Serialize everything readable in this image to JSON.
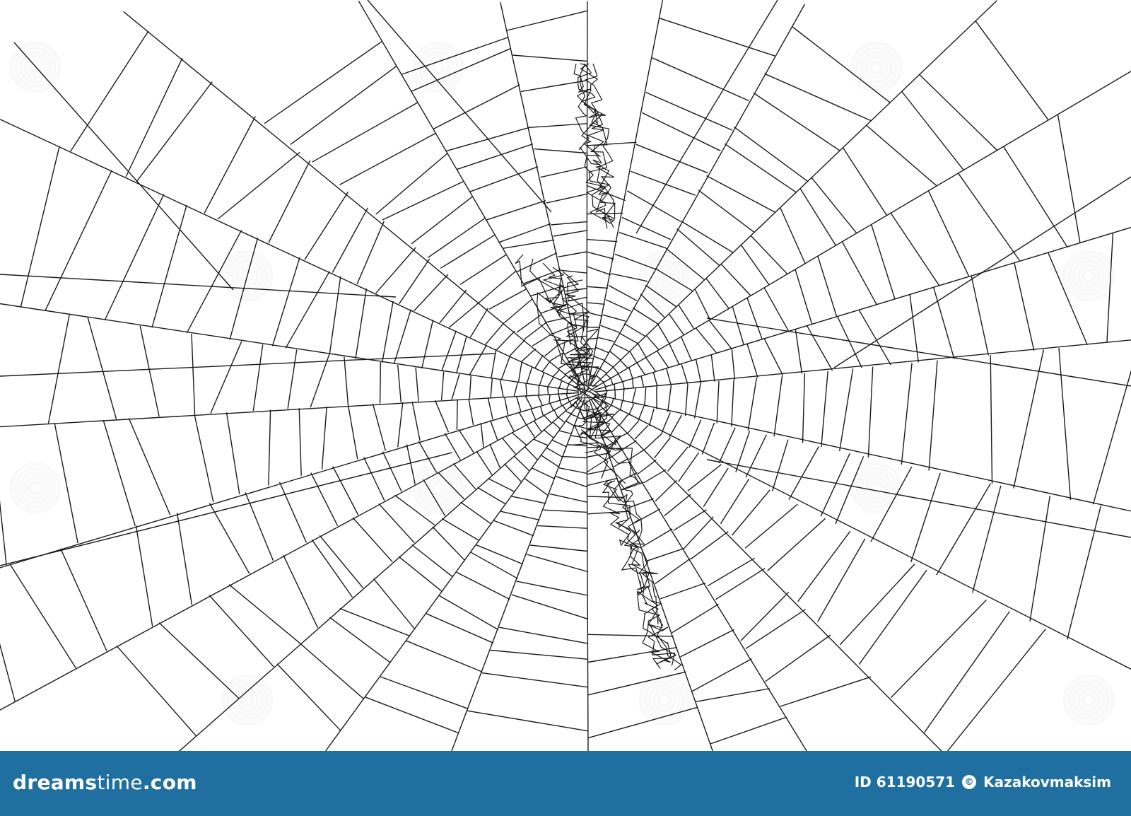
{
  "image": {
    "subject": "spider-web-line-illustration",
    "background_color": "#ffffff",
    "line_color": "#1a1a1a"
  },
  "watermark": {
    "icon": "dreamstime-spiral-icon",
    "color": "#c8c8c8"
  },
  "footer": {
    "background_color": "#1f6fa0",
    "text_color": "#ffffff",
    "logo_part1": "dreams",
    "logo_part2": "time",
    "logo_suffix": ".com",
    "id_label": "ID 61190571",
    "copyright_icon": "copyright-icon",
    "author": "Kazakovmaksim"
  }
}
